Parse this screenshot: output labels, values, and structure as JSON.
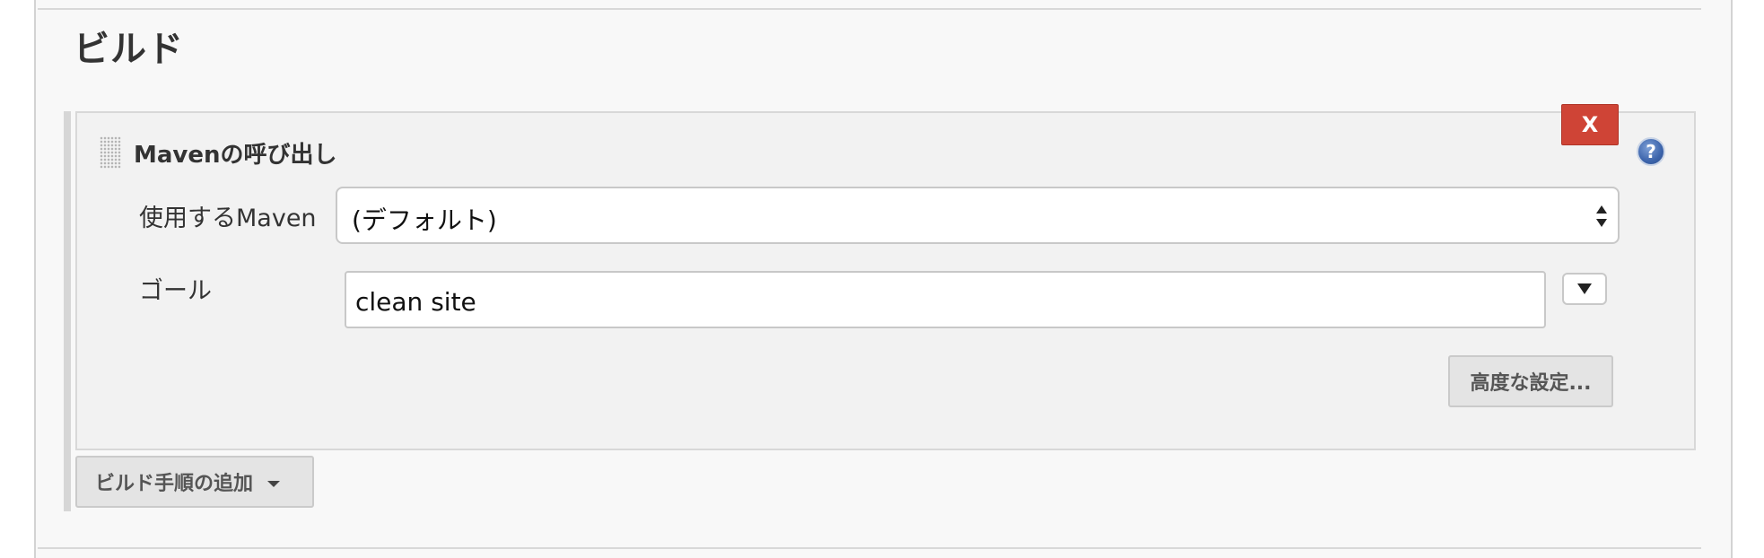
{
  "section": {
    "title": "ビルド"
  },
  "build_step": {
    "title": "Mavenの呼び出し",
    "delete_label": "X",
    "help_label": "?",
    "maven_version": {
      "label": "使用するMaven",
      "selected": "(デフォルト)"
    },
    "goals": {
      "label": "ゴール",
      "value": "clean site"
    },
    "advanced_label": "高度な設定..."
  },
  "add_step": {
    "label": "ビルド手順の追加"
  },
  "colors": {
    "delete_button": "#cf4436",
    "panel_background": "#f2f2f2",
    "help_icon": "#3c64ab"
  },
  "icons": {
    "drag": "drag-handle-icon",
    "help": "help-icon",
    "select": "select-arrows-icon",
    "expand": "triangle-down-icon",
    "dropdown": "caret-down-icon"
  }
}
